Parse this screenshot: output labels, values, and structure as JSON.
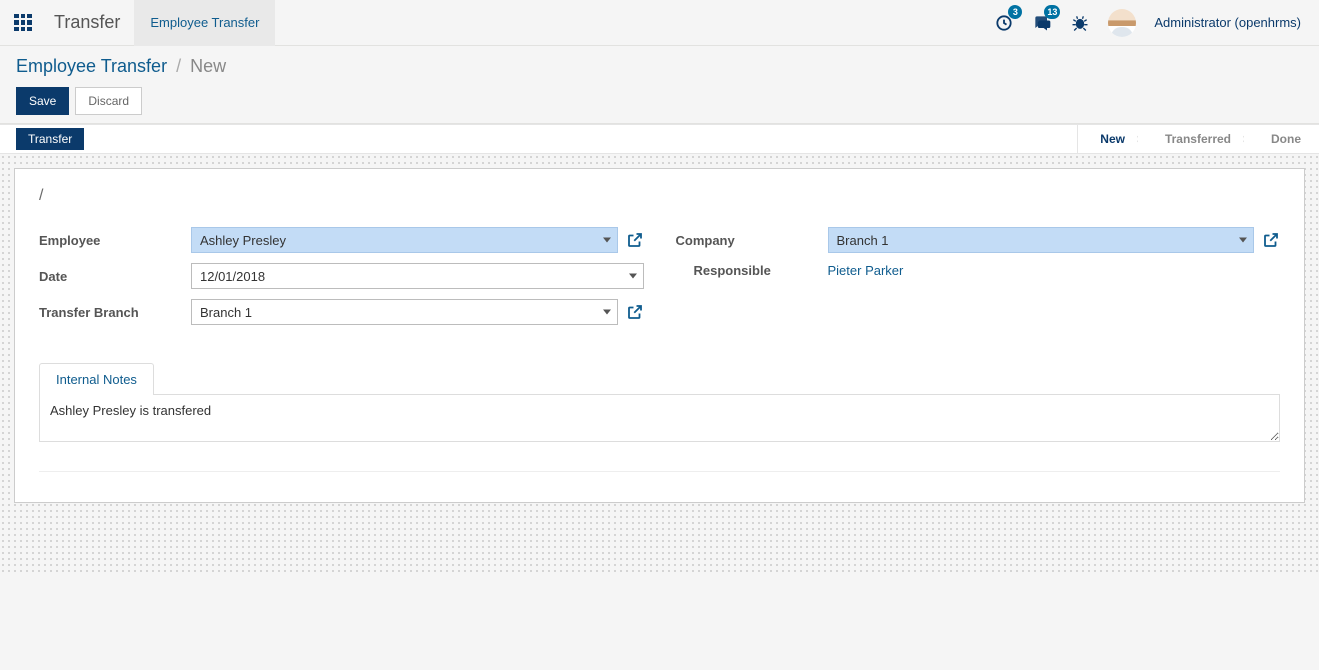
{
  "navbar": {
    "app_name": "Transfer",
    "submenu": "Employee Transfer",
    "activities_badge": "3",
    "discuss_badge": "13",
    "user_display": "Administrator (openhrms)"
  },
  "breadcrumb": {
    "root": "Employee Transfer",
    "current": "New"
  },
  "buttons": {
    "save": "Save",
    "discard": "Discard"
  },
  "action_button": "Transfer",
  "status": {
    "new": "New",
    "transferred": "Transferred",
    "done": "Done"
  },
  "sheet": {
    "title": "/",
    "labels": {
      "employee": "Employee",
      "date": "Date",
      "transfer_branch": "Transfer Branch",
      "company": "Company",
      "responsible": "Responsible"
    },
    "values": {
      "employee": "Ashley Presley",
      "date": "12/01/2018",
      "transfer_branch": "Branch 1",
      "company": "Branch 1",
      "responsible": "Pieter Parker"
    },
    "tab_label": "Internal Notes",
    "notes": "Ashley Presley is transfered"
  }
}
